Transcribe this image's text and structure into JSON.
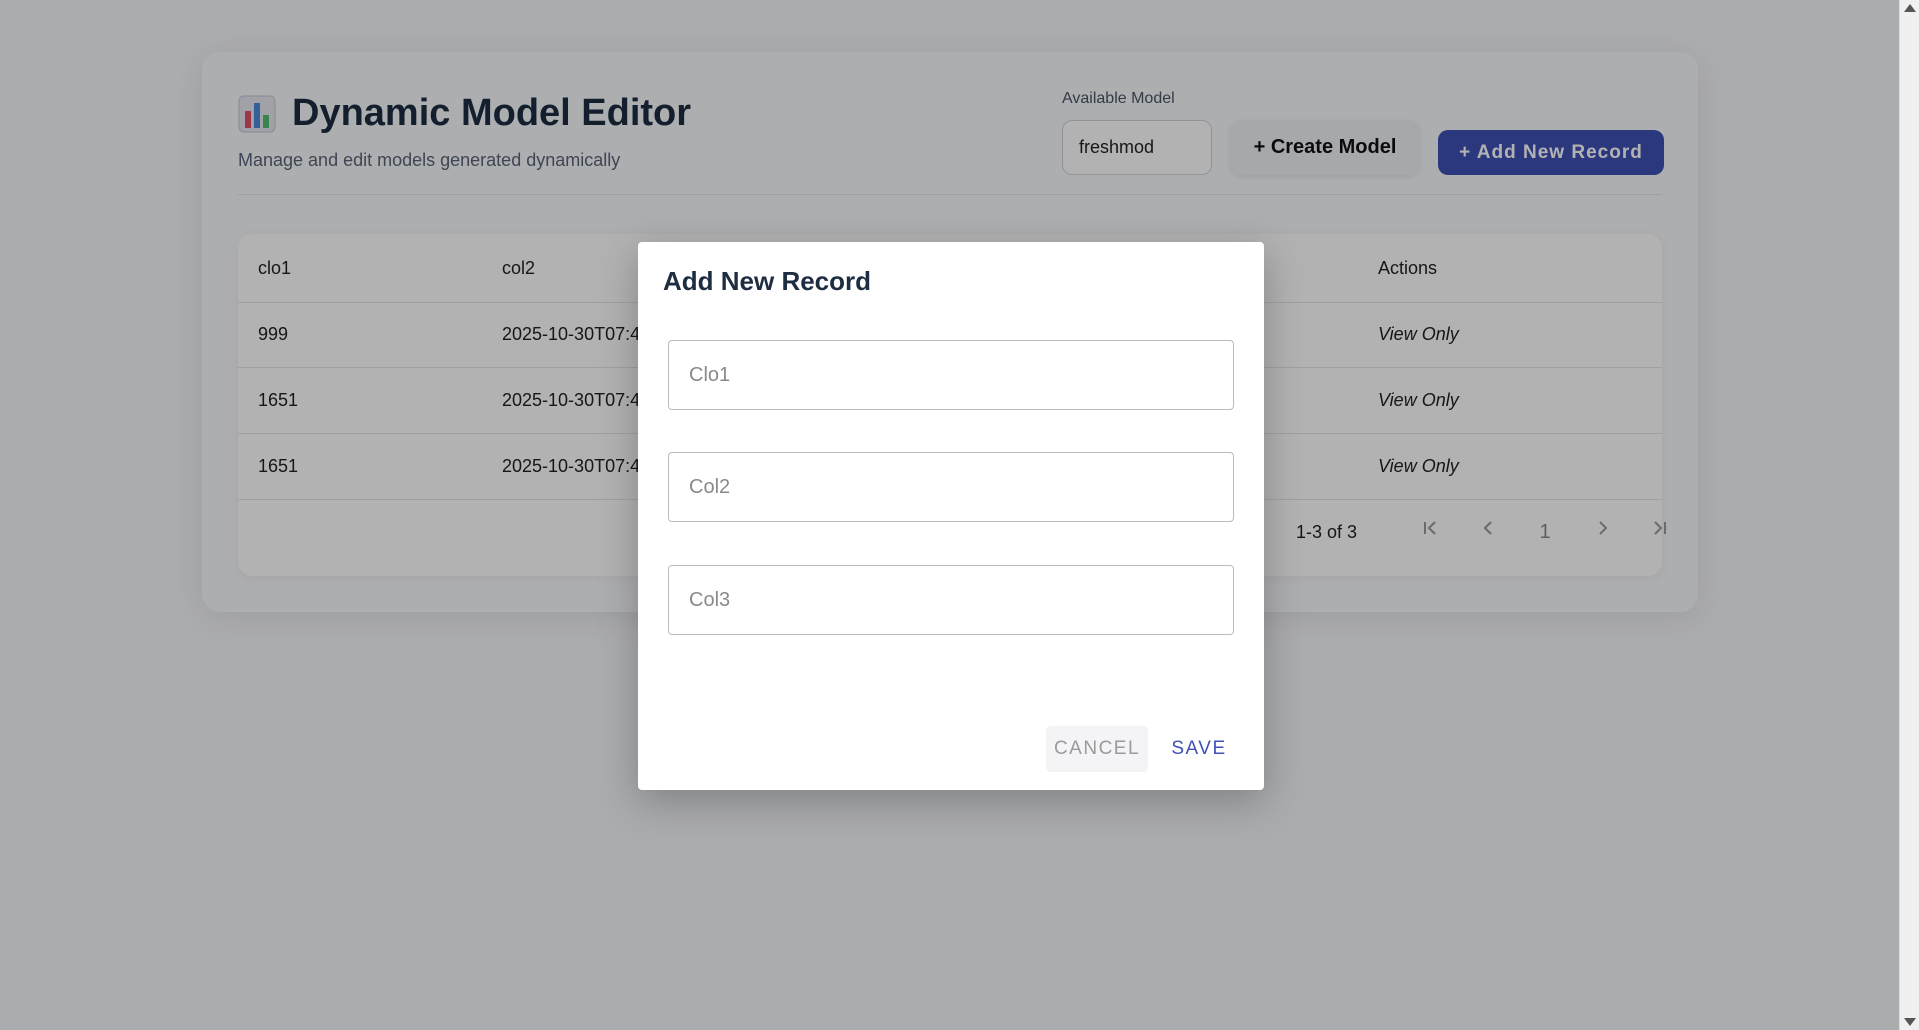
{
  "header": {
    "title": "Dynamic Model Editor",
    "subtitle": "Manage and edit models generated dynamically",
    "icon": "bar-chart-icon"
  },
  "model_picker": {
    "label": "Available Model",
    "selected": "freshmod"
  },
  "actions": {
    "create_model": "+ Create Model",
    "add_record": "+ Add New Record"
  },
  "table": {
    "columns": [
      "clo1",
      "col2",
      "Actions"
    ],
    "rows": [
      {
        "clo1": "999",
        "col2": "2025-10-30T07:4",
        "action": "View Only"
      },
      {
        "clo1": "1651",
        "col2": "2025-10-30T07:4",
        "action": "View Only"
      },
      {
        "clo1": "1651",
        "col2": "2025-10-30T07:4",
        "action": "View Only"
      }
    ],
    "pagination": {
      "range": "1-3 of 3",
      "current_page": "1"
    }
  },
  "dialog": {
    "title": "Add New Record",
    "fields": [
      {
        "placeholder": "Clo1",
        "value": ""
      },
      {
        "placeholder": "Col2",
        "value": ""
      },
      {
        "placeholder": "Col3",
        "value": ""
      }
    ],
    "cancel_label": "CANCEL",
    "save_label": "SAVE"
  },
  "colors": {
    "primary": "#3f51b5",
    "title_text": "#1e2d42",
    "overlay": "rgba(0,0,0,0.3)"
  }
}
